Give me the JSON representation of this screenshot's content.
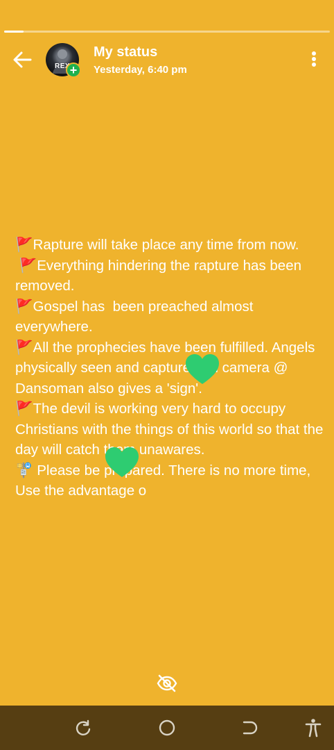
{
  "status": {
    "progress": 0.06,
    "title": "My status",
    "time": "Yesterday, 6:40 pm",
    "avatar_text": "REX",
    "add_badge": "+",
    "lines": [
      "🚩Rapture will take place any time from now.",
      " 🚩Everything hindering the rapture has been removed.",
      "🚩Gospel has  been preached almost everywhere.",
      "🚩All the prophecies have been fulfilled. Angels physically seen and captured on camera @ Dansoman also gives a 'sign'.",
      "🚩The devil is working very hard to occupy Christians with the things of this world so that the day will catch them unawares.",
      "🚏 Please be prepared. There is no more time, Use the advantage o"
    ]
  },
  "reactions": [
    "green-heart-icon",
    "green-heart-icon"
  ],
  "icons": {
    "back": "arrow-left-icon",
    "menu": "more-vertical-icon",
    "seen": "eye-off-icon",
    "nav": [
      "recent-apps-icon",
      "home-icon",
      "back-nav-icon",
      "accessibility-icon"
    ]
  },
  "colors": {
    "background": "#efb32d",
    "heart": "#2ecc71",
    "navbar": "#563e12",
    "badge": "#1fb14e"
  }
}
